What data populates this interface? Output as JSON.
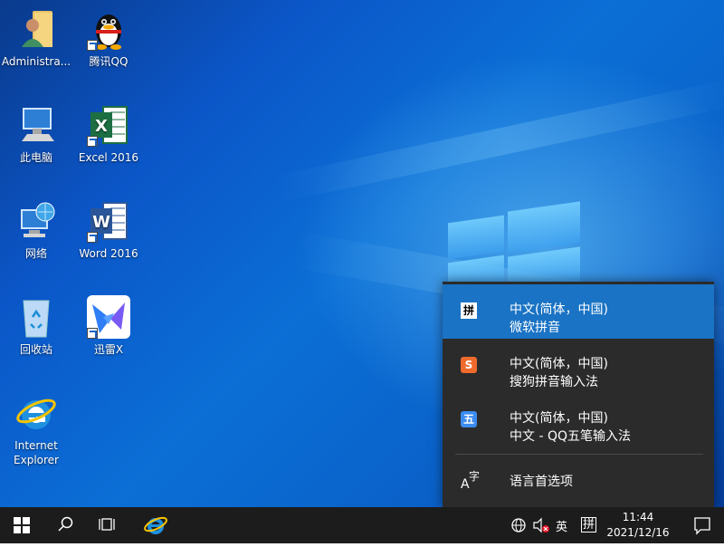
{
  "desktop": {
    "icons": [
      {
        "label": "Administra...",
        "icon": "user-folder-icon"
      },
      {
        "label": "腾讯QQ",
        "icon": "qq-penguin-icon"
      },
      {
        "label": "此电脑",
        "icon": "computer-icon"
      },
      {
        "label": "Excel 2016",
        "icon": "excel-icon"
      },
      {
        "label": "网络",
        "icon": "network-icon"
      },
      {
        "label": "Word 2016",
        "icon": "word-icon"
      },
      {
        "label": "回收站",
        "icon": "recycle-bin-icon"
      },
      {
        "label": "迅雷X",
        "icon": "xunlei-bird-icon"
      },
      {
        "label": "Internet Explorer",
        "icon": "ie-icon"
      }
    ]
  },
  "ime_menu": {
    "items": [
      {
        "icon_text": "拼",
        "line1": "中文(简体，中国)",
        "line2": "微软拼音",
        "selected": true
      },
      {
        "icon_text": "S",
        "line1": "中文(简体，中国)",
        "line2": "搜狗拼音输入法",
        "selected": false
      },
      {
        "icon_text": "五",
        "line1": "中文(简体，中国)",
        "line2": "中文 - QQ五笔输入法",
        "selected": false
      }
    ],
    "preferences_label": "语言首选项",
    "preferences_icon_text": "A字"
  },
  "taskbar": {
    "tray": {
      "lang_indicator": "英",
      "ime_indicator": "拼"
    },
    "clock": {
      "time": "11:44",
      "date": "2021/12/16"
    }
  },
  "colors": {
    "selected_item": "#1a73c4",
    "panel_bg": "#2b2b2b",
    "taskbar_bg": "#1c1c1c"
  }
}
